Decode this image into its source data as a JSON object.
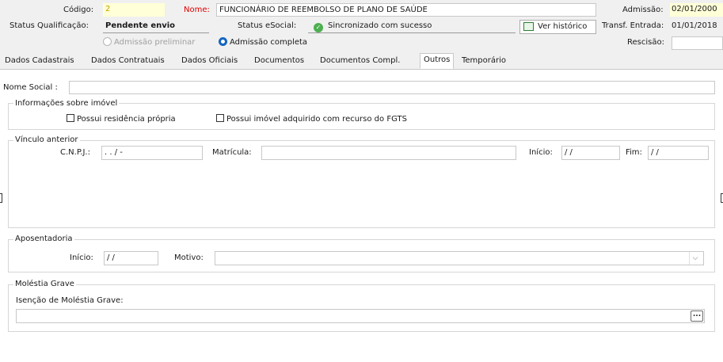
{
  "header": {
    "codigo_label": "Código:",
    "codigo_value": "2",
    "nome_label": "Nome:",
    "nome_value": "FUNCIONÁRIO DE REEMBOLSO DE PLANO DE SAÚDE",
    "admissao_label": "Admissão:",
    "admissao_value": "02/01/2000",
    "status_qual_label": "Status Qualificação:",
    "status_qual_value": "Pendente envio",
    "status_esocial_label": "Status eSocial:",
    "status_esocial_value": "Sincronizado com sucesso",
    "ver_historico_label": "Ver histórico",
    "transf_label": "Transf. Entrada:",
    "transf_value": "01/01/2018",
    "rescisao_label": "Rescisão:",
    "rescisao_value": "",
    "radio_preliminar_label": "Admissão preliminar",
    "radio_completa_label": "Admissão completa",
    "accent_red": "#e00000",
    "accent_blue": "#1565c0"
  },
  "tabs": [
    {
      "label": "Dados Cadastrais"
    },
    {
      "label": "Dados Contratuais"
    },
    {
      "label": "Dados Oficiais"
    },
    {
      "label": "Documentos"
    },
    {
      "label": "Documentos Compl."
    },
    {
      "label": "Outros",
      "active": true
    },
    {
      "label": "Temporário"
    }
  ],
  "form": {
    "nome_social_label": "Nome Social :",
    "nome_social_value": "",
    "imovel": {
      "title": "Informações sobre imóvel",
      "chk_residencia": "Possui residência própria",
      "chk_fgts": "Possui imóvel adquirido com recurso do FGTS"
    },
    "vinculo": {
      "title": "Vínculo anterior",
      "cnpj_label": "C.N.P.J.:",
      "cnpj_value": " .  .  /   -",
      "matricula_label": "Matrícula:",
      "matricula_value": "",
      "inicio_label": "Início:",
      "inicio_value": " / /",
      "fim_label": "Fim:",
      "fim_value": " / /"
    },
    "aposentadoria": {
      "title": "Aposentadoria",
      "inicio_label": "Início:",
      "inicio_value": " / /",
      "motivo_label": "Motivo:",
      "motivo_value": ""
    },
    "molestia": {
      "title": "Moléstia Grave",
      "isencao_label": "Isenção de Moléstia Grave:",
      "isencao_value": "",
      "ellipsis_label": "..."
    }
  }
}
